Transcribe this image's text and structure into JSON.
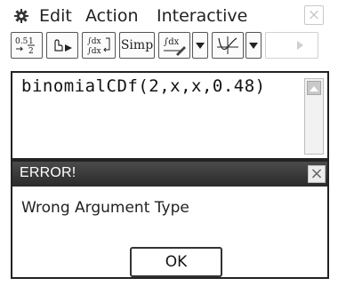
{
  "menu": {
    "gear_icon": "gear-icon",
    "items": [
      {
        "label": "Edit"
      },
      {
        "label": "Action"
      },
      {
        "label": "Interactive"
      }
    ],
    "close_glyph": "×"
  },
  "toolbar": {
    "simp_label": "Simp",
    "buttons": [
      {
        "icon": "decimal-fraction-icon"
      },
      {
        "icon": "drag-pointer-icon"
      },
      {
        "icon": "integral-toggle-icon"
      },
      {
        "label": "Simp"
      },
      {
        "icon": "integral-edit-icon"
      },
      {
        "icon": "dropdown-arrow-icon"
      },
      {
        "icon": "graph-icon"
      },
      {
        "icon": "dropdown-arrow-icon"
      },
      {
        "icon": "right-arrow-icon"
      }
    ]
  },
  "editor": {
    "expression": "binomialCDf(2,x,x,0.48)"
  },
  "dialog": {
    "title": "ERROR!",
    "message": "Wrong Argument Type",
    "ok_label": "OK",
    "close_glyph": "×"
  },
  "colors": {
    "dialog_header": "#2f2f2f",
    "text": "#222222"
  }
}
